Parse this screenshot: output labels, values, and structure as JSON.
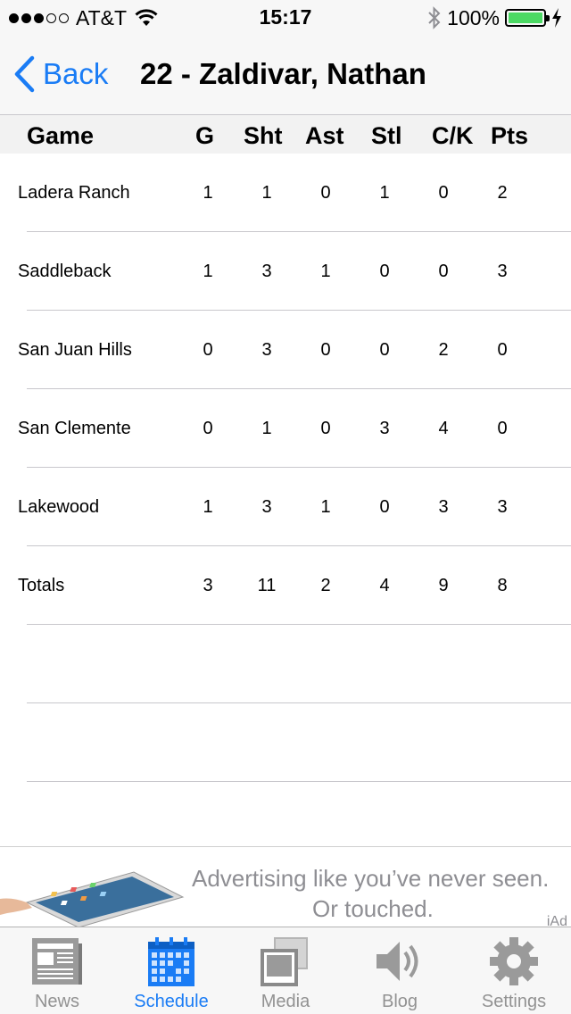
{
  "status_bar": {
    "carrier": "AT&T",
    "time": "15:17",
    "battery_percent": "100%",
    "signal_bars": 3
  },
  "nav": {
    "back_label": "Back",
    "title": "22 - Zaldivar, Nathan"
  },
  "table": {
    "columns": [
      "Game",
      "G",
      "Sht",
      "Ast",
      "Stl",
      "C/K",
      "Pts"
    ],
    "rows": [
      [
        "Ladera Ranch",
        "1",
        "1",
        "0",
        "1",
        "0",
        "2"
      ],
      [
        "Saddleback",
        "1",
        "3",
        "1",
        "0",
        "0",
        "3"
      ],
      [
        "San Juan Hills",
        "0",
        "3",
        "0",
        "0",
        "2",
        "0"
      ],
      [
        "San Clemente",
        "0",
        "1",
        "0",
        "3",
        "4",
        "0"
      ],
      [
        "Lakewood",
        "1",
        "3",
        "1",
        "0",
        "3",
        "3"
      ],
      [
        "Totals",
        "3",
        "11",
        "2",
        "4",
        "9",
        "8"
      ],
      [
        "",
        "",
        "",
        "",
        "",
        "",
        ""
      ],
      [
        "",
        "",
        "",
        "",
        "",
        "",
        ""
      ],
      [
        "",
        "",
        "",
        "",
        "",
        "",
        ""
      ]
    ]
  },
  "ad": {
    "line1": "Advertising like you’ve never seen.",
    "line2": "Or touched.",
    "brand": "iAd"
  },
  "tabs": [
    {
      "label": "News",
      "icon": "newspaper-icon"
    },
    {
      "label": "Schedule",
      "icon": "calendar-icon"
    },
    {
      "label": "Media",
      "icon": "photos-icon"
    },
    {
      "label": "Blog",
      "icon": "speaker-icon"
    },
    {
      "label": "Settings",
      "icon": "gear-icon"
    }
  ],
  "active_tab": "Schedule",
  "colors": {
    "accent": "#1a7cf5",
    "tab_inactive": "#929292",
    "battery": "#4cd964",
    "separator": "#c8c7cc"
  }
}
